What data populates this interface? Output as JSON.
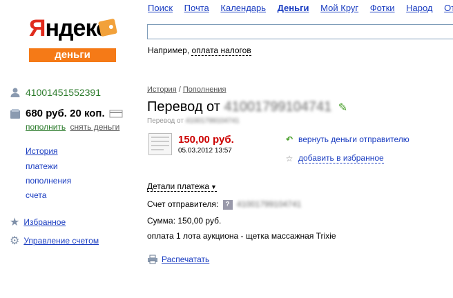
{
  "logo": {
    "word_first": "Я",
    "word_rest": "ндекс",
    "sub": "деньги"
  },
  "nav": [
    {
      "label": "Поиск"
    },
    {
      "label": "Почта"
    },
    {
      "label": "Календарь"
    },
    {
      "label": "Деньги",
      "active": true
    },
    {
      "label": "Мой Круг"
    },
    {
      "label": "Фотки"
    },
    {
      "label": "Народ"
    },
    {
      "label": "Отк"
    }
  ],
  "search": {
    "value": "",
    "hint_prefix": "Например, ",
    "hint_example": "оплата налогов"
  },
  "account": {
    "number": "41001451552391",
    "balance": "680 руб. 20 коп.",
    "topup_label": "пополнить",
    "withdraw_label": "снять деньги"
  },
  "sidebar": {
    "history": "История",
    "payments": "платежи",
    "topups": "пополнения",
    "bills": "счета",
    "favorites": "Избранное",
    "account_settings": "Управление счетом"
  },
  "breadcrumb": {
    "history": "История",
    "sep": " / ",
    "topups": "Пополнения"
  },
  "transfer": {
    "title_prefix": "Перевод от",
    "sender_blurred": "41001799104741",
    "subtitle_prefix": "Перевод от",
    "subtitle_blurred": "41001799104741",
    "amount": "150,00 руб.",
    "datetime": "05.03.2012 13:57",
    "return_label": "вернуть деньги отправителю",
    "favorite_label": "добавить в избранное"
  },
  "details": {
    "toggle_label": "Детали платежа",
    "sender_label": "Счет отправителя:",
    "sender_value_blurred": "41001799104741",
    "sum_line": "Сумма: 150,00 руб.",
    "comment": "оплата 1 лота аукциона - щетка массажная Trixie",
    "print_label": "Распечатать"
  },
  "colors": {
    "brand_red": "#e02b1d",
    "brand_orange": "#f57a17",
    "link": "#1a3dc1",
    "amount_red": "#cc0000",
    "green": "#2a7a2a"
  }
}
